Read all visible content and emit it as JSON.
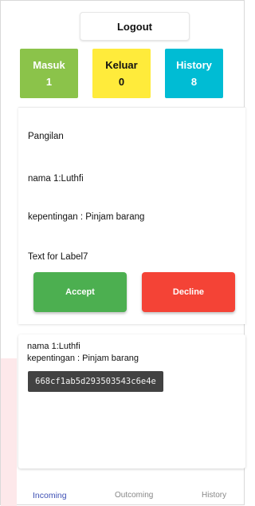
{
  "header": {
    "logout_label": "Logout"
  },
  "stats": [
    {
      "label": "Masuk",
      "value": "1",
      "color": "#8bc34a"
    },
    {
      "label": "Keluar",
      "value": "0",
      "color": "#ffeb3b"
    },
    {
      "label": "History",
      "value": "8",
      "color": "#00bcd4"
    }
  ],
  "request_card": {
    "title": "Pangilan",
    "nama": "nama 1:Luthfi",
    "kepentingan": "kepentingan : Pinjam barang",
    "label7": "Text for Label7",
    "accept_label": "Accept",
    "decline_label": "Decline",
    "accept_color": "#4caf50",
    "decline_color": "#f44336"
  },
  "detail_card": {
    "line1": "nama 1:Luthfi",
    "line2": "kepentingan : Pinjam barang",
    "id_tooltip": "668cf1ab5d293503543c6e4e"
  },
  "bottom_nav": {
    "items": [
      "Incoming",
      "Outcoming",
      "History"
    ],
    "active": "Incoming",
    "active_color": "#3f51b5"
  }
}
